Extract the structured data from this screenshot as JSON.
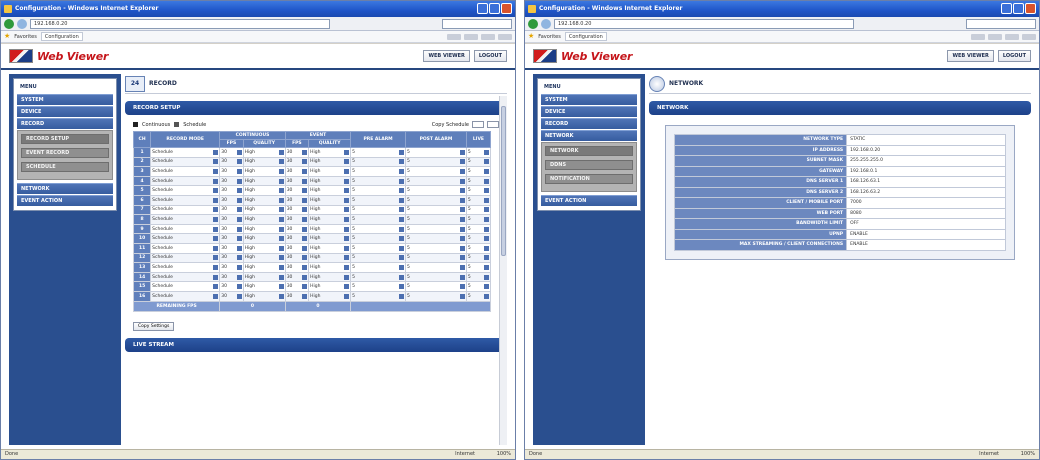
{
  "browser": {
    "left_title": "Configuration - Windows Internet Explorer",
    "right_title": "Configuration - Windows Internet Explorer",
    "left_url": "192.168.0.20",
    "right_url": "192.168.0.20",
    "fav_tab": "Configuration",
    "favorites": "Favorites",
    "status_left": "Done",
    "status_zone": "Internet",
    "status_zoom": "100%"
  },
  "header": {
    "logo": "Web Viewer",
    "web_viewer_btn": "WEB VIEWER",
    "logout_btn": "LOGOUT"
  },
  "left": {
    "menu_title": "MENU",
    "menu_items": [
      "SYSTEM",
      "DEVICE",
      "RECORD"
    ],
    "submenu": [
      "RECORD SETUP",
      "EVENT RECORD",
      "SCHEDULE"
    ],
    "menu_items_after": [
      "NETWORK",
      "EVENT ACTION"
    ],
    "page_icon": "24",
    "page_title": "RECORD",
    "section_title": "RECORD SETUP",
    "legend_continuous": "Continuous",
    "legend_schedule": "Schedule",
    "legend_right": "Copy Schedule",
    "columns": [
      "CH",
      "RECORD MODE",
      "FPS",
      "QUALITY",
      "FPS",
      "QUALITY",
      "PRE ALARM",
      "POST ALARM",
      "LIVE"
    ],
    "group_headers": [
      "CONTINUOUS",
      "EVENT"
    ],
    "rows": [
      {
        "ch": "1",
        "mode": "Schedule",
        "fps1": "30",
        "q1": "High",
        "fps2": "30",
        "q2": "High",
        "pre": "5",
        "post": "5",
        "live": "5"
      },
      {
        "ch": "2",
        "mode": "Schedule",
        "fps1": "30",
        "q1": "High",
        "fps2": "30",
        "q2": "High",
        "pre": "5",
        "post": "5",
        "live": "5"
      },
      {
        "ch": "3",
        "mode": "Schedule",
        "fps1": "30",
        "q1": "High",
        "fps2": "30",
        "q2": "High",
        "pre": "5",
        "post": "5",
        "live": "5"
      },
      {
        "ch": "4",
        "mode": "Schedule",
        "fps1": "30",
        "q1": "High",
        "fps2": "30",
        "q2": "High",
        "pre": "5",
        "post": "5",
        "live": "5"
      },
      {
        "ch": "5",
        "mode": "Schedule",
        "fps1": "30",
        "q1": "High",
        "fps2": "30",
        "q2": "High",
        "pre": "5",
        "post": "5",
        "live": "5"
      },
      {
        "ch": "6",
        "mode": "Schedule",
        "fps1": "30",
        "q1": "High",
        "fps2": "30",
        "q2": "High",
        "pre": "5",
        "post": "5",
        "live": "5"
      },
      {
        "ch": "7",
        "mode": "Schedule",
        "fps1": "30",
        "q1": "High",
        "fps2": "30",
        "q2": "High",
        "pre": "5",
        "post": "5",
        "live": "5"
      },
      {
        "ch": "8",
        "mode": "Schedule",
        "fps1": "30",
        "q1": "High",
        "fps2": "30",
        "q2": "High",
        "pre": "5",
        "post": "5",
        "live": "5"
      },
      {
        "ch": "9",
        "mode": "Schedule",
        "fps1": "30",
        "q1": "High",
        "fps2": "30",
        "q2": "High",
        "pre": "5",
        "post": "5",
        "live": "5"
      },
      {
        "ch": "10",
        "mode": "Schedule",
        "fps1": "30",
        "q1": "High",
        "fps2": "30",
        "q2": "High",
        "pre": "5",
        "post": "5",
        "live": "5"
      },
      {
        "ch": "11",
        "mode": "Schedule",
        "fps1": "30",
        "q1": "High",
        "fps2": "30",
        "q2": "High",
        "pre": "5",
        "post": "5",
        "live": "5"
      },
      {
        "ch": "12",
        "mode": "Schedule",
        "fps1": "30",
        "q1": "High",
        "fps2": "30",
        "q2": "High",
        "pre": "5",
        "post": "5",
        "live": "5"
      },
      {
        "ch": "13",
        "mode": "Schedule",
        "fps1": "30",
        "q1": "High",
        "fps2": "30",
        "q2": "High",
        "pre": "5",
        "post": "5",
        "live": "5"
      },
      {
        "ch": "14",
        "mode": "Schedule",
        "fps1": "30",
        "q1": "High",
        "fps2": "30",
        "q2": "High",
        "pre": "5",
        "post": "5",
        "live": "5"
      },
      {
        "ch": "15",
        "mode": "Schedule",
        "fps1": "30",
        "q1": "High",
        "fps2": "30",
        "q2": "High",
        "pre": "5",
        "post": "5",
        "live": "5"
      },
      {
        "ch": "16",
        "mode": "Schedule",
        "fps1": "30",
        "q1": "High",
        "fps2": "30",
        "q2": "High",
        "pre": "5",
        "post": "5",
        "live": "5"
      }
    ],
    "total_label": "REMAINING FPS",
    "total_val1": "0",
    "total_val2": "0",
    "copy_btn": "Copy Settings",
    "live_stream_title": "LIVE STREAM"
  },
  "right": {
    "menu_title": "MENU",
    "menu_items": [
      "SYSTEM",
      "DEVICE",
      "RECORD",
      "NETWORK"
    ],
    "submenu": [
      "NETWORK",
      "DDNS",
      "NOTIFICATION"
    ],
    "menu_items_after": [
      "EVENT ACTION"
    ],
    "page_title": "NETWORK",
    "section_title": "NETWORK",
    "fields": [
      {
        "label": "NETWORK TYPE",
        "value": "STATIC"
      },
      {
        "label": "IP ADDRESS",
        "value": "192.168.0.20"
      },
      {
        "label": "SUBNET MASK",
        "value": "255.255.255.0"
      },
      {
        "label": "GATEWAY",
        "value": "192.168.0.1"
      },
      {
        "label": "DNS SERVER 1",
        "value": "168.126.63.1"
      },
      {
        "label": "DNS SERVER 2",
        "value": "168.126.63.2"
      },
      {
        "label": "CLIENT / MOBILE PORT",
        "value": "7000"
      },
      {
        "label": "WEB PORT",
        "value": "8080"
      },
      {
        "label": "BANDWIDTH LIMIT",
        "value": "OFF"
      },
      {
        "label": "UPNP",
        "value": "ENABLE"
      },
      {
        "label": "MAX STREAMING / CLIENT CONNECTIONS",
        "value": "ENABLE"
      }
    ]
  }
}
